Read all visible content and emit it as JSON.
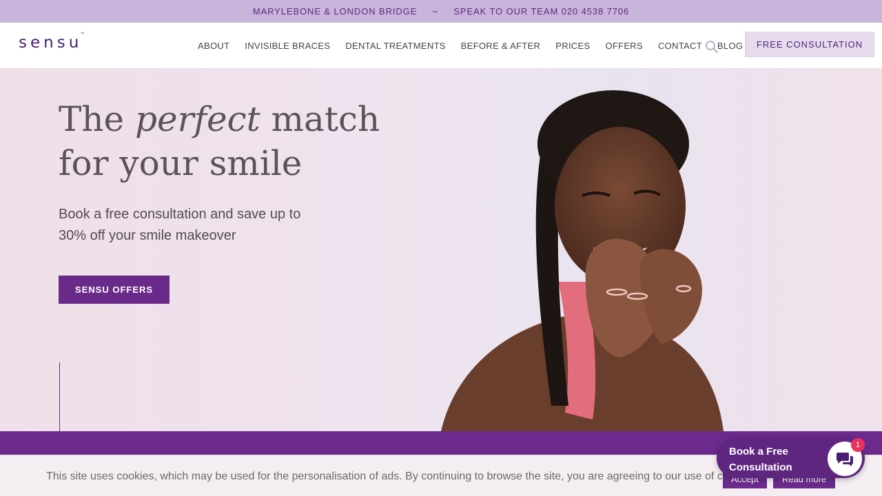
{
  "topbar": {
    "locations": "MARYLEBONE & LONDON BRIDGE",
    "separator": "~",
    "phone": "SPEAK TO OUR TEAM 020 4538 7706"
  },
  "header": {
    "logo": "sensu",
    "logo_tm": "™",
    "menu": [
      "ABOUT",
      "INVISIBLE BRACES",
      "DENTAL TREATMENTS",
      "BEFORE & AFTER",
      "PRICES",
      "OFFERS",
      "CONTACT",
      "BLOG"
    ],
    "search_icon": "search-icon",
    "cta": "FREE CONSULTATION"
  },
  "hero": {
    "title_part1": "The ",
    "title_emphasis": "perfect",
    "title_part2": " match",
    "title_line2": "for your smile",
    "subtitle": "Book a free consultation and save up to 30% off your smile makeover",
    "button": "SENSU OFFERS"
  },
  "cookie": {
    "text": "This site uses cookies, which may be used for the personalisation of ads. By continuing to browse the site, you are agreeing to our use of cookies.",
    "accept": "Accept",
    "read_more": "Read more"
  },
  "chat": {
    "label": "Book a Free Consultation",
    "badge": "1",
    "icon": "chat-icon"
  },
  "colors": {
    "brand_purple": "#6b2a8c",
    "topbar": "#c9b4db",
    "hero_bg": "#f0dfe9",
    "badge": "#e9335e"
  }
}
